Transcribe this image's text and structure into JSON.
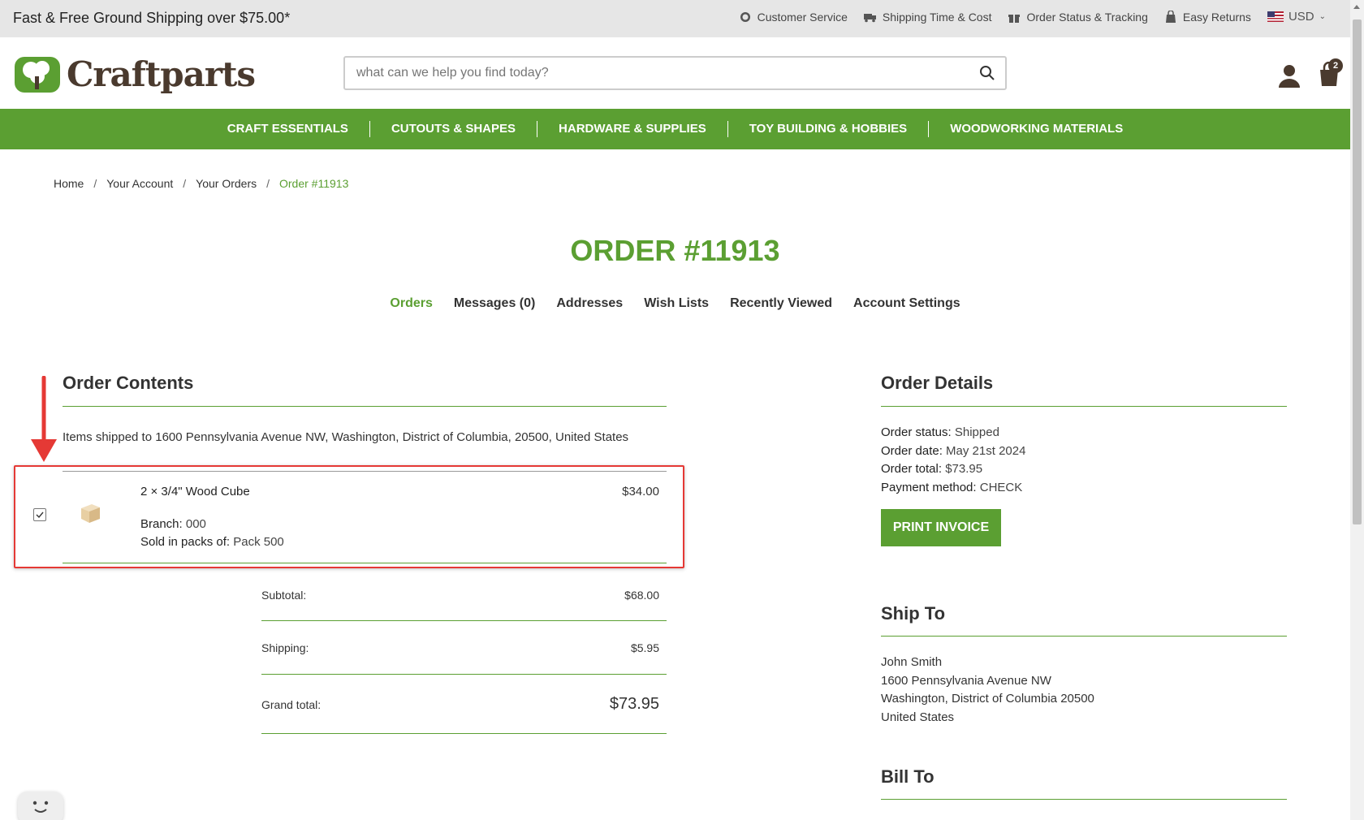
{
  "topbar": {
    "promo": "Fast & Free Ground Shipping over $75.00*",
    "links": [
      "Customer Service",
      "Shipping Time & Cost",
      "Order Status & Tracking",
      "Easy Returns"
    ],
    "currency": "USD"
  },
  "header": {
    "logo_text": "Craftparts",
    "search_placeholder": "what can we help you find today?",
    "cart_count": "2"
  },
  "nav": [
    "CRAFT ESSENTIALS",
    "CUTOUTS & SHAPES",
    "HARDWARE & SUPPLIES",
    "TOY BUILDING & HOBBIES",
    "WOODWORKING MATERIALS"
  ],
  "breadcrumb": [
    "Home",
    "Your Account",
    "Your Orders",
    "Order #11913"
  ],
  "page_title": "ORDER #11913",
  "account_tabs": [
    "Orders",
    "Messages (0)",
    "Addresses",
    "Wish Lists",
    "Recently Viewed",
    "Account Settings"
  ],
  "order_contents": {
    "heading": "Order Contents",
    "shipped_to": "Items shipped to 1600 Pennsylvania Avenue NW, Washington, District of Columbia, 20500, United States",
    "item": {
      "name": "2 × 3/4\" Wood Cube",
      "price": "$34.00",
      "branch_label": "Branch:",
      "branch_value": "000",
      "pack_label": "Sold in packs of:",
      "pack_value": "Pack 500",
      "checked": true
    },
    "totals": {
      "subtotal_label": "Subtotal:",
      "subtotal": "$68.00",
      "shipping_label": "Shipping:",
      "shipping": "$5.95",
      "grand_label": "Grand total:",
      "grand": "$73.95"
    }
  },
  "order_details": {
    "heading": "Order Details",
    "status_label": "Order status:",
    "status": "Shipped",
    "date_label": "Order date:",
    "date": "May 21st 2024",
    "total_label": "Order total:",
    "total": "$73.95",
    "payment_label": "Payment method:",
    "payment": "CHECK",
    "print_button": "PRINT INVOICE"
  },
  "ship_to": {
    "heading": "Ship To",
    "lines": [
      "John Smith",
      "1600 Pennsylvania Avenue NW",
      "Washington, District of Columbia 20500",
      "United States"
    ]
  },
  "bill_to": {
    "heading": "Bill To"
  },
  "colors": {
    "brand_green": "#5b9f32",
    "annotation_red": "#e53935",
    "brand_brown": "#4a3a2e"
  }
}
